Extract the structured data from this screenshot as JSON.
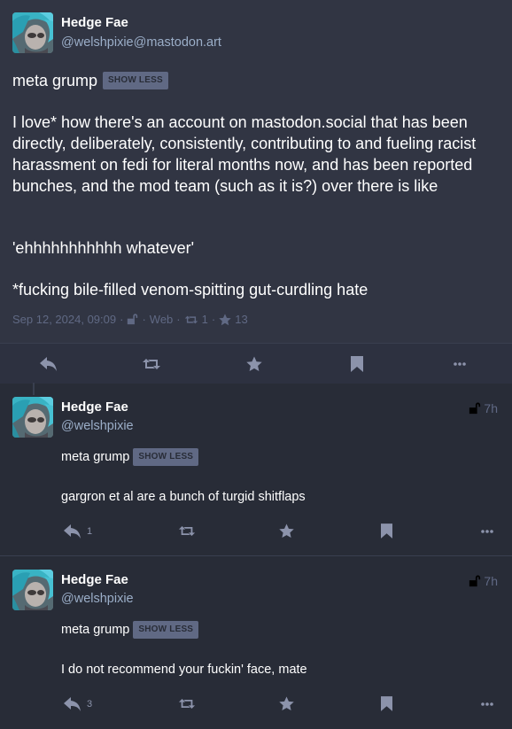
{
  "colors": {
    "background": "#282c37",
    "main_status_bg": "#313543",
    "secondary_text": "#9baec8",
    "muted_text": "#606984",
    "cw_button_bg": "#606984"
  },
  "main_status": {
    "display_name": "Hedge Fae",
    "account": "@welshpixie@mastodon.art",
    "content_warning": "meta grump",
    "cw_button": "SHOW LESS",
    "paragraphs": [
      "I love* how there's an account on mastodon.social that has been directly, deliberately, consistently, contributing to and fueling racist harassment on fedi for literal months now, and has been reported bunches, and the mod team (such as it is?) over there is like",
      "'ehhhhhhhhhhh whatever'",
      "*fucking bile-filled venom-spitting gut-curdling hate"
    ],
    "timestamp": "Sep 12, 2024, 09:09",
    "visibility_icon": "unlock-icon",
    "sep": "·",
    "application": "Web",
    "boost_count": "1",
    "favourite_count": "13",
    "actions": [
      "reply-icon",
      "boost-icon",
      "star-icon",
      "bookmark-icon",
      "ellipsis-icon"
    ]
  },
  "replies": [
    {
      "display_name": "Hedge Fae",
      "account": "@welshpixie",
      "time": "7h",
      "content_warning": "meta grump",
      "cw_button": "SHOW LESS",
      "text": "gargron et al are a bunch of turgid shitflaps",
      "reply_count": "1"
    },
    {
      "display_name": "Hedge Fae",
      "account": "@welshpixie",
      "time": "7h",
      "content_warning": "meta grump",
      "cw_button": "SHOW LESS",
      "text": "I do not recommend your fuckin' face, mate",
      "reply_count": "3"
    }
  ]
}
